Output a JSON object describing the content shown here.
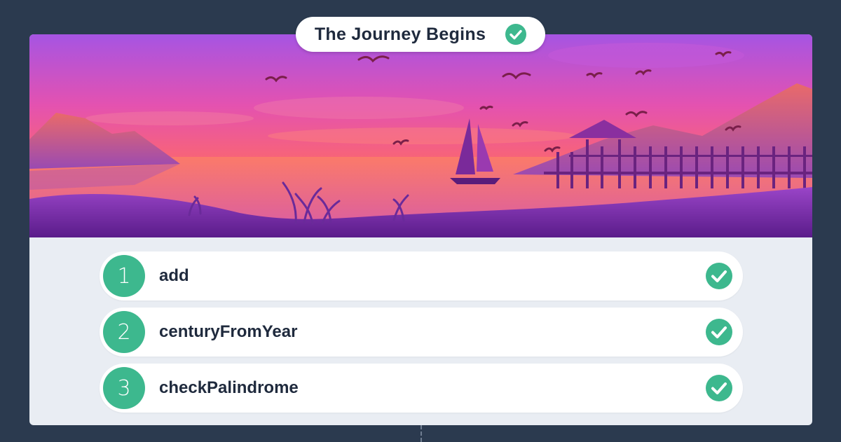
{
  "header": {
    "title": "The Journey Begins",
    "status_icon": "check-circle-icon",
    "status": "completed"
  },
  "levels": [
    {
      "number": "1",
      "name": "add",
      "status_icon": "check-circle-icon"
    },
    {
      "number": "2",
      "name": "centuryFromYear",
      "status_icon": "check-circle-icon"
    },
    {
      "number": "3",
      "name": "checkPalindrome",
      "status_icon": "check-circle-icon"
    }
  ],
  "colors": {
    "background": "#2b3a4f",
    "card": "#e9edf3",
    "accent_green": "#3db88e",
    "text_dark": "#1f2a3d"
  }
}
